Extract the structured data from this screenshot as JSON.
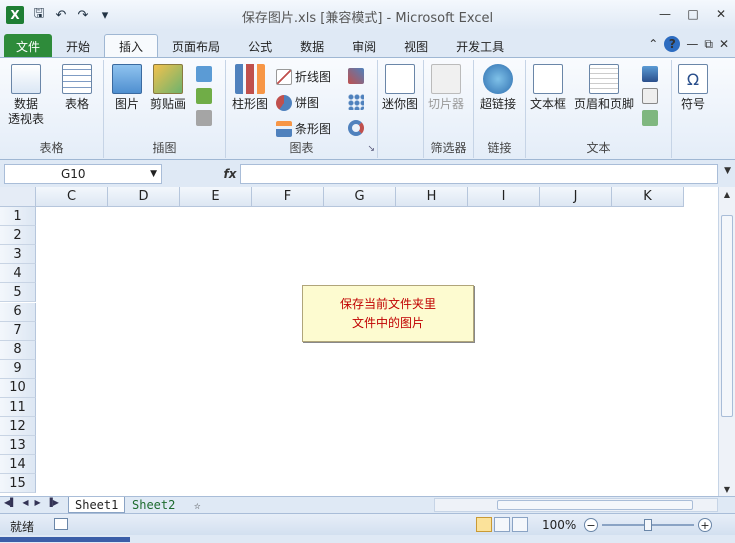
{
  "titlebar": {
    "app_icon_label": "X",
    "title": "保存图片.xls  [兼容模式]  -  Microsoft Excel",
    "qat": [
      "save-icon",
      "undo-icon",
      "redo-icon",
      "customize-icon"
    ],
    "controls": [
      "minimize-icon",
      "maximize-icon",
      "close-icon"
    ]
  },
  "tabs": [
    {
      "label": "文件"
    },
    {
      "label": "开始"
    },
    {
      "label": "插入"
    },
    {
      "label": "页面布局"
    },
    {
      "label": "公式"
    },
    {
      "label": "数据"
    },
    {
      "label": "审阅"
    },
    {
      "label": "视图"
    },
    {
      "label": "开发工具"
    }
  ],
  "ribbon": {
    "groups": {
      "tables": "表格",
      "illustrations": "插图",
      "charts": "图表",
      "slicer": "筛选器",
      "links": "链接",
      "text": "文本"
    },
    "buttons": {
      "pivot": "数据\n透视表",
      "pivot_1": "数据",
      "pivot_2": "透视表",
      "table": "表格",
      "picture": "图片",
      "clipart": "剪贴画",
      "column_chart": "柱形图",
      "line_chart": "折线图",
      "pie_chart": "饼图",
      "bar_chart": "条形图",
      "sparkline": "迷你图",
      "slicer": "切片器",
      "hyperlink": "超链接",
      "textbox": "文本框",
      "header_footer": "页眉和页脚",
      "symbol": "符号"
    }
  },
  "formula_bar": {
    "name_box": "G10",
    "fx": "fx",
    "value": ""
  },
  "grid": {
    "columns": [
      "C",
      "D",
      "E",
      "F",
      "G",
      "H",
      "I",
      "J",
      "K"
    ],
    "rows": [
      "1",
      "2",
      "3",
      "4",
      "5",
      "6",
      "7",
      "8",
      "9",
      "10",
      "11",
      "12",
      "13",
      "14",
      "15"
    ],
    "button": {
      "line1": "保存当前文件夹里",
      "line2": "文件中的图片"
    }
  },
  "sheets": [
    {
      "label": "Sheet1"
    },
    {
      "label": "Sheet2"
    }
  ],
  "status": {
    "ready": "就绪",
    "zoom": "100%"
  }
}
